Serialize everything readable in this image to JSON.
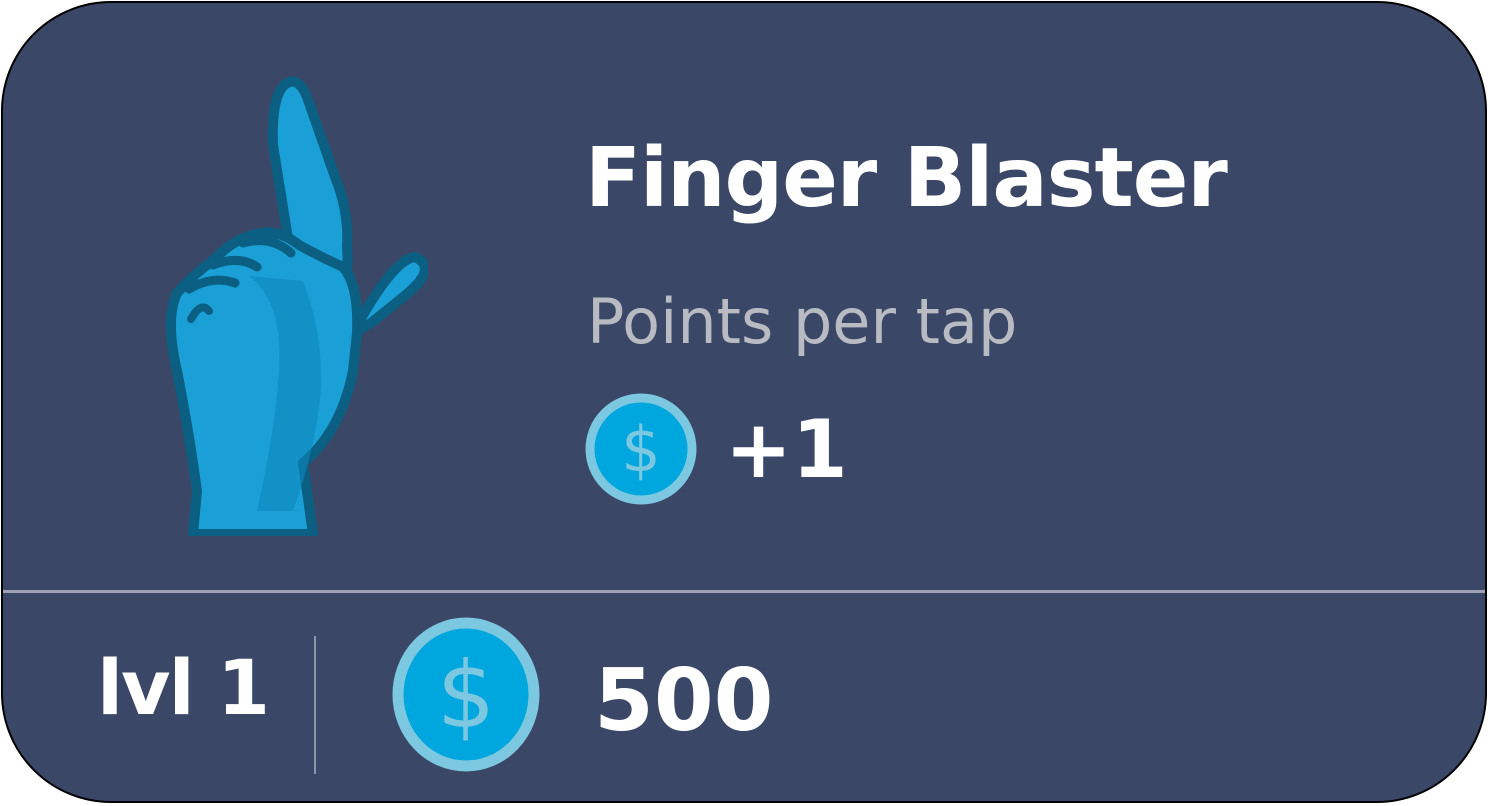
{
  "upgrade": {
    "title": "Finger Blaster",
    "subtitle": "Points per tap",
    "bonus": "+1",
    "level": "lvl 1",
    "cost": "500"
  },
  "icons": {
    "illustration": "pointing-finger-hand",
    "currency": "dollar-coin"
  },
  "colors": {
    "card_background": "#3a4767",
    "hand_fill": "#1aa0d6",
    "hand_outline": "#0b5f82",
    "coin_fill": "#00a7de",
    "coin_ring": "#7cc8e0",
    "subtitle_text": "#b9bbc2"
  }
}
